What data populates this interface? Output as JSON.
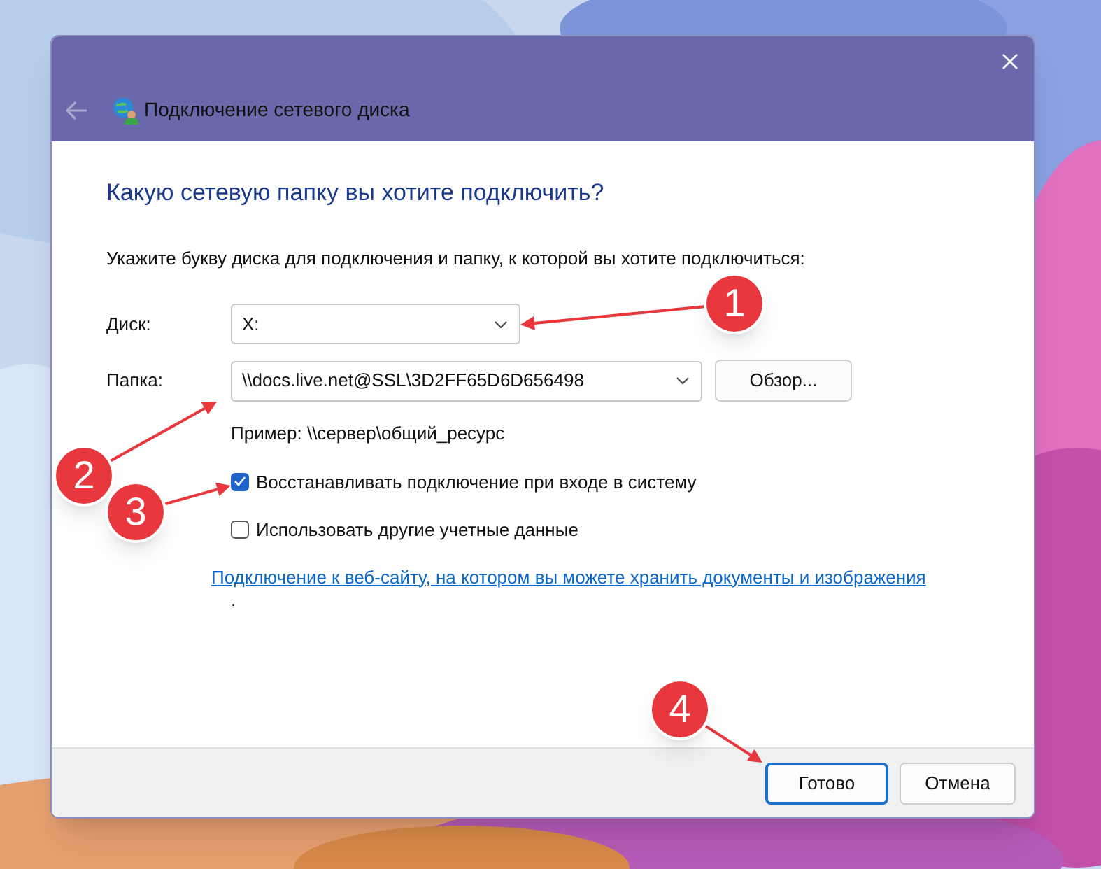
{
  "window": {
    "title": "Подключение сетевого диска"
  },
  "heading": "Какую сетевую папку вы хотите подключить?",
  "instruction": "Укажите букву диска для подключения и папку, к которой вы хотите подключиться:",
  "fields": [
    {
      "label": "Диск:",
      "value": "X:"
    },
    {
      "label": "Папка:",
      "value": "\\\\docs.live.net@SSL\\3D2FF65D6D656498"
    }
  ],
  "browse_button": "Обзор...",
  "example": "Пример: \\\\сервер\\общий_ресурс",
  "checkboxes": [
    {
      "label": "Восстанавливать подключение при входе в систему",
      "checked": true
    },
    {
      "label": "Использовать другие учетные данные",
      "checked": false
    }
  ],
  "link": "Подключение к веб-сайту, на котором вы можете хранить документы и изображения",
  "link_trailing": ".",
  "buttons": [
    {
      "label": "Готово",
      "default": true
    },
    {
      "label": "Отмена",
      "default": false
    }
  ],
  "callouts": [
    {
      "label": "1"
    },
    {
      "label": "2"
    },
    {
      "label": "3"
    },
    {
      "label": "4"
    }
  ]
}
